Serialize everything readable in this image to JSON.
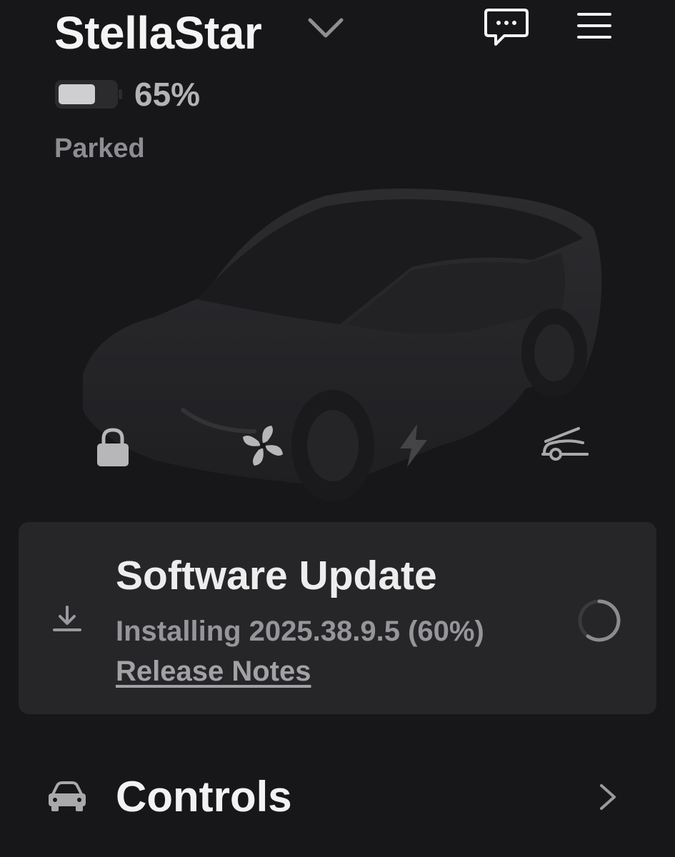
{
  "header": {
    "vehicle_name": "StellaStar",
    "icons": {
      "dropdown": "chevron-down-icon",
      "messages": "chat-bubble-icon",
      "menu": "hamburger-menu-icon"
    }
  },
  "battery": {
    "percent_label": "65%",
    "level": 0.65
  },
  "status": "Parked",
  "quick_controls": [
    {
      "name": "lock",
      "icon": "lock-icon"
    },
    {
      "name": "climate",
      "icon": "fan-icon"
    },
    {
      "name": "charge",
      "icon": "lightning-bolt-icon"
    },
    {
      "name": "frunk",
      "icon": "frunk-open-icon"
    }
  ],
  "software_update": {
    "title": "Software Update",
    "status_text": "Installing 2025.38.9.5 (60%)",
    "release_notes_label": "Release Notes",
    "progress": 0.6
  },
  "controls": {
    "label": "Controls"
  },
  "colors": {
    "background": "#17171a",
    "card": "#262629",
    "text": "#f2f2f2",
    "muted": "#96969a"
  }
}
